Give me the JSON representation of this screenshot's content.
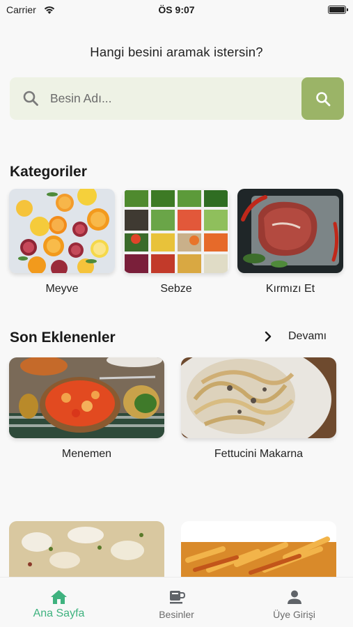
{
  "status_bar": {
    "carrier": "Carrier",
    "time": "ÖS 9:07"
  },
  "prompt": "Hangi besini aramak istersin?",
  "search": {
    "placeholder": "Besin Adı...",
    "value": ""
  },
  "categories_section": {
    "title": "Kategoriler",
    "items": [
      {
        "label": "Meyve",
        "icon": "fruit-photo"
      },
      {
        "label": "Sebze",
        "icon": "vegetable-photo"
      },
      {
        "label": "Kırmızı Et",
        "icon": "red-meat-photo"
      }
    ]
  },
  "recent_section": {
    "title": "Son Eklenenler",
    "more_label": "Devamı",
    "items": [
      {
        "label": "Menemen",
        "icon": "menemen-photo"
      },
      {
        "label": "Fettucini Makarna",
        "icon": "fettuccine-photo"
      }
    ]
  },
  "tab_bar": {
    "tabs": [
      {
        "label": "Ana Sayfa",
        "icon": "home-icon",
        "active": true
      },
      {
        "label": "Besinler",
        "icon": "coffee-icon",
        "active": false
      },
      {
        "label": "Üye Girişi",
        "icon": "user-icon",
        "active": false
      }
    ]
  },
  "colors": {
    "accent": "#3fb27f",
    "search_button": "#9bb467",
    "search_bg": "#eef2e5",
    "background": "#f8f8f8"
  }
}
